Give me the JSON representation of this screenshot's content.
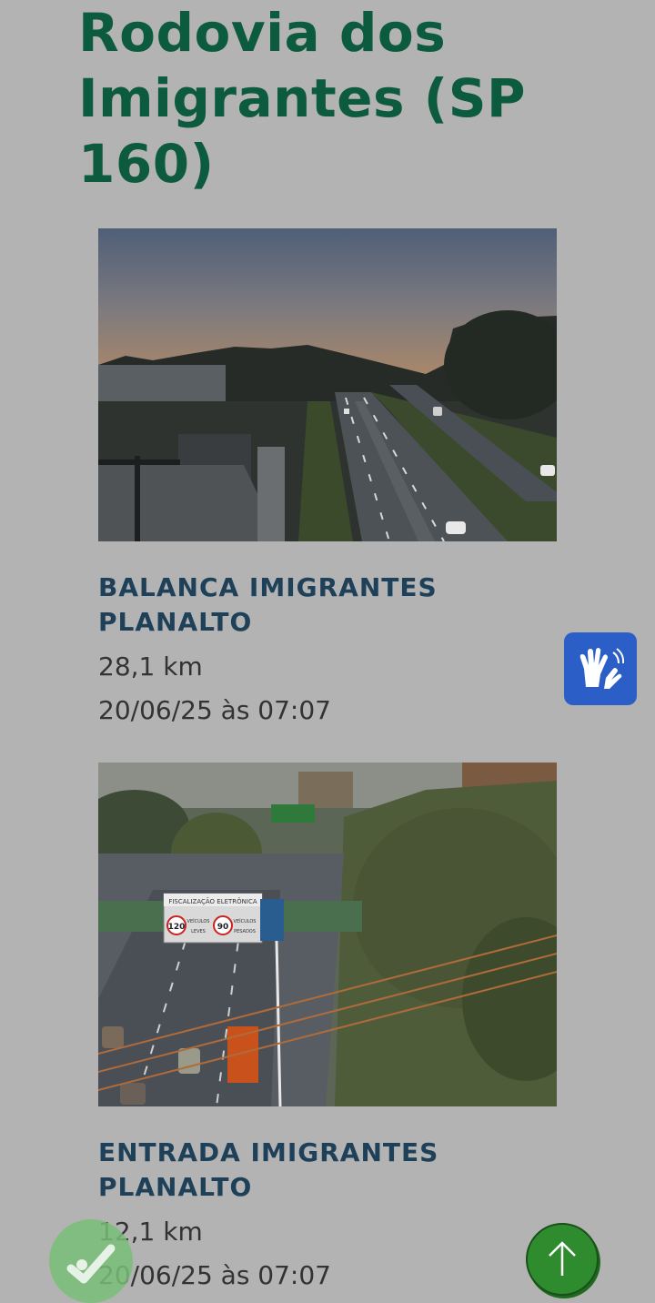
{
  "page": {
    "title": "Rodovia dos Imigrantes (SP 160)"
  },
  "cameras": [
    {
      "name": "BALANCA IMIGRANTES PLANALTO",
      "km": "28,1 km",
      "updated": "20/06/25 às 07:07",
      "image_desc": "traffic-camera-image"
    },
    {
      "name": "ENTRADA IMIGRANTES PLANALTO",
      "km": "12,1 km",
      "updated": "20/06/25 às 07:07",
      "image_desc": "traffic-camera-image"
    }
  ],
  "sign": {
    "header": "FISCALIZAÇÃO ELETRÔNICA",
    "limit1": "120",
    "label1a": "VEÍCULOS",
    "label1b": "LEVES",
    "limit2": "90",
    "label2a": "VEÍCULOS",
    "label2b": "PESADOS"
  },
  "colors": {
    "title": "#0d5b3f",
    "camera_name": "#1e4058",
    "libras_button": "#2b5fc7",
    "back_to_top": "#2e8b2e"
  },
  "icons": {
    "libras": "hands-sign-language-icon",
    "consent": "cookie-consent-icon",
    "back_to_top": "arrow-up-icon"
  }
}
